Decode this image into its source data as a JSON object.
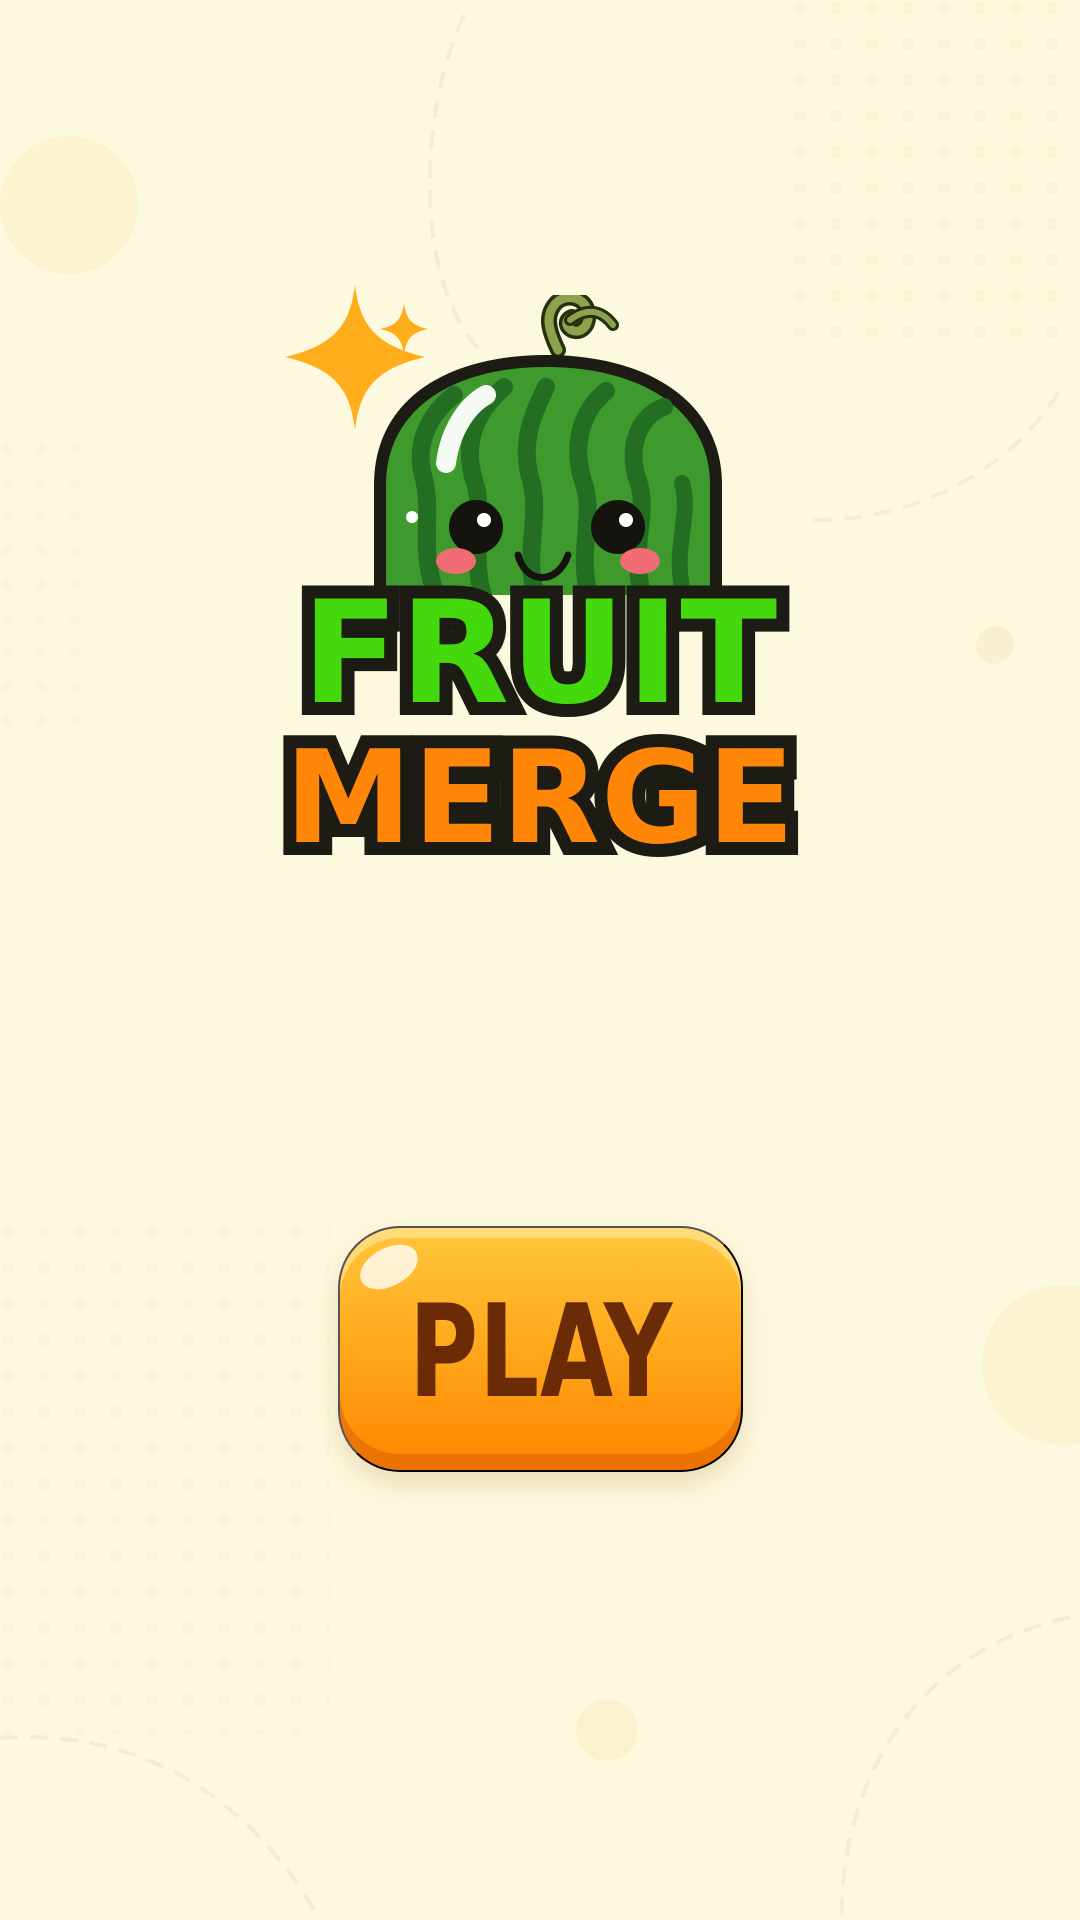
{
  "screen": {
    "title_top": "FRUIT",
    "title_bottom": "MERGE",
    "play_label": "PLAY"
  },
  "theme": {
    "background": "#fdf9df",
    "title_top_color": "#44d90d",
    "title_bottom_color": "#ff8606",
    "outline_color": "#1c1b14",
    "button_color": "#ffab1d",
    "button_text_color": "#6a2b06",
    "watermelon_primary": "#3e9a2d",
    "watermelon_stripes": "#1f6a1f",
    "sparkle_color": "#ffad1a"
  },
  "icons": {
    "sparkle": "sparkle-icon",
    "watermelon": "watermelon-icon"
  }
}
